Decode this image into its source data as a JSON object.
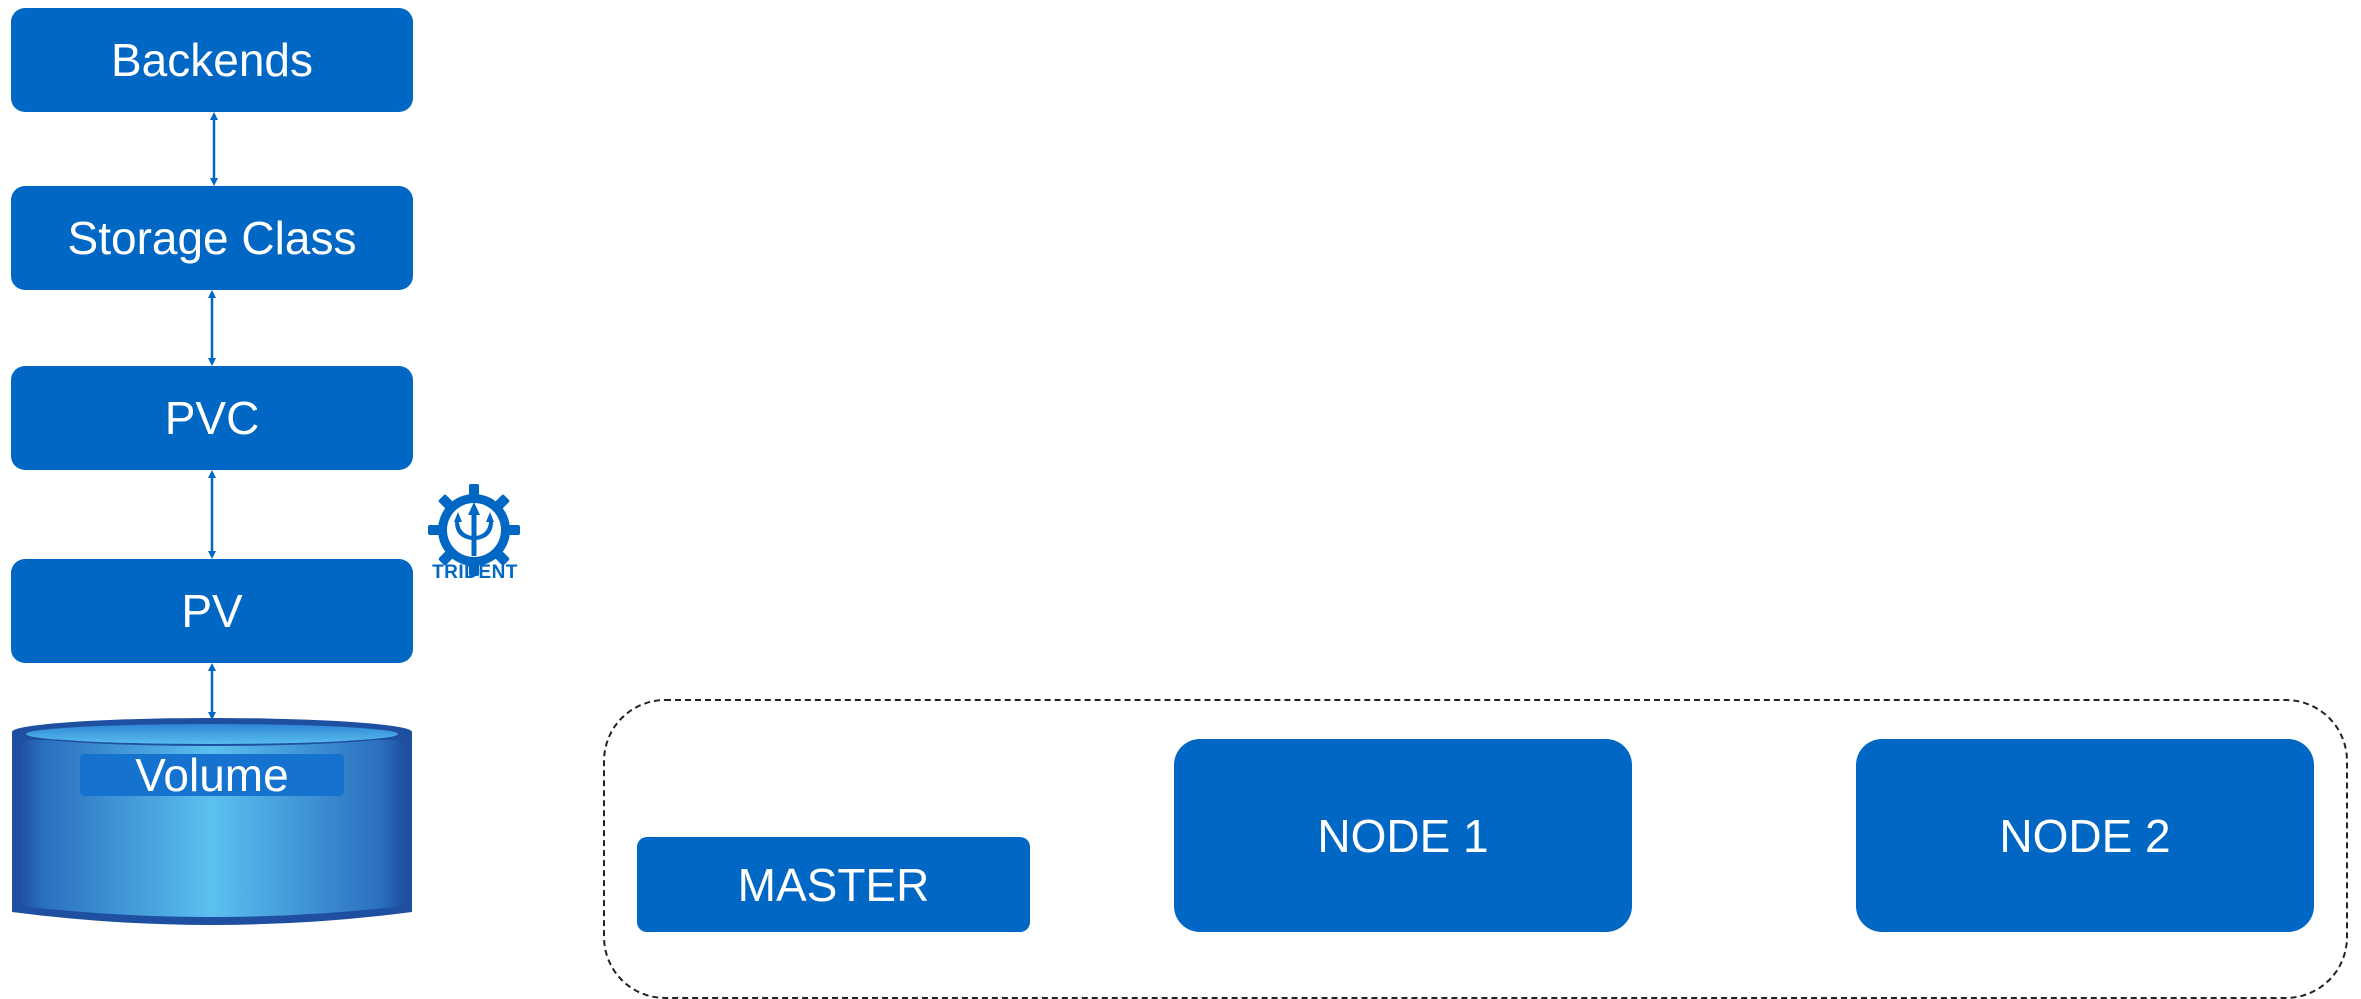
{
  "colors": {
    "primary_blue": "#0067c5",
    "volume_light": "#5bc1ef",
    "volume_dark": "#1f4fa0",
    "cluster_border": "#222222"
  },
  "stack": {
    "backends": "Backends",
    "storage_class": "Storage Class",
    "pvc": "PVC",
    "pv": "PV",
    "volume": "Volume"
  },
  "logo": {
    "icon": "trident-gear-icon",
    "text": "TRIDENT"
  },
  "cluster": {
    "master": "MASTER",
    "node1": "NODE 1",
    "node2": "NODE 2"
  }
}
